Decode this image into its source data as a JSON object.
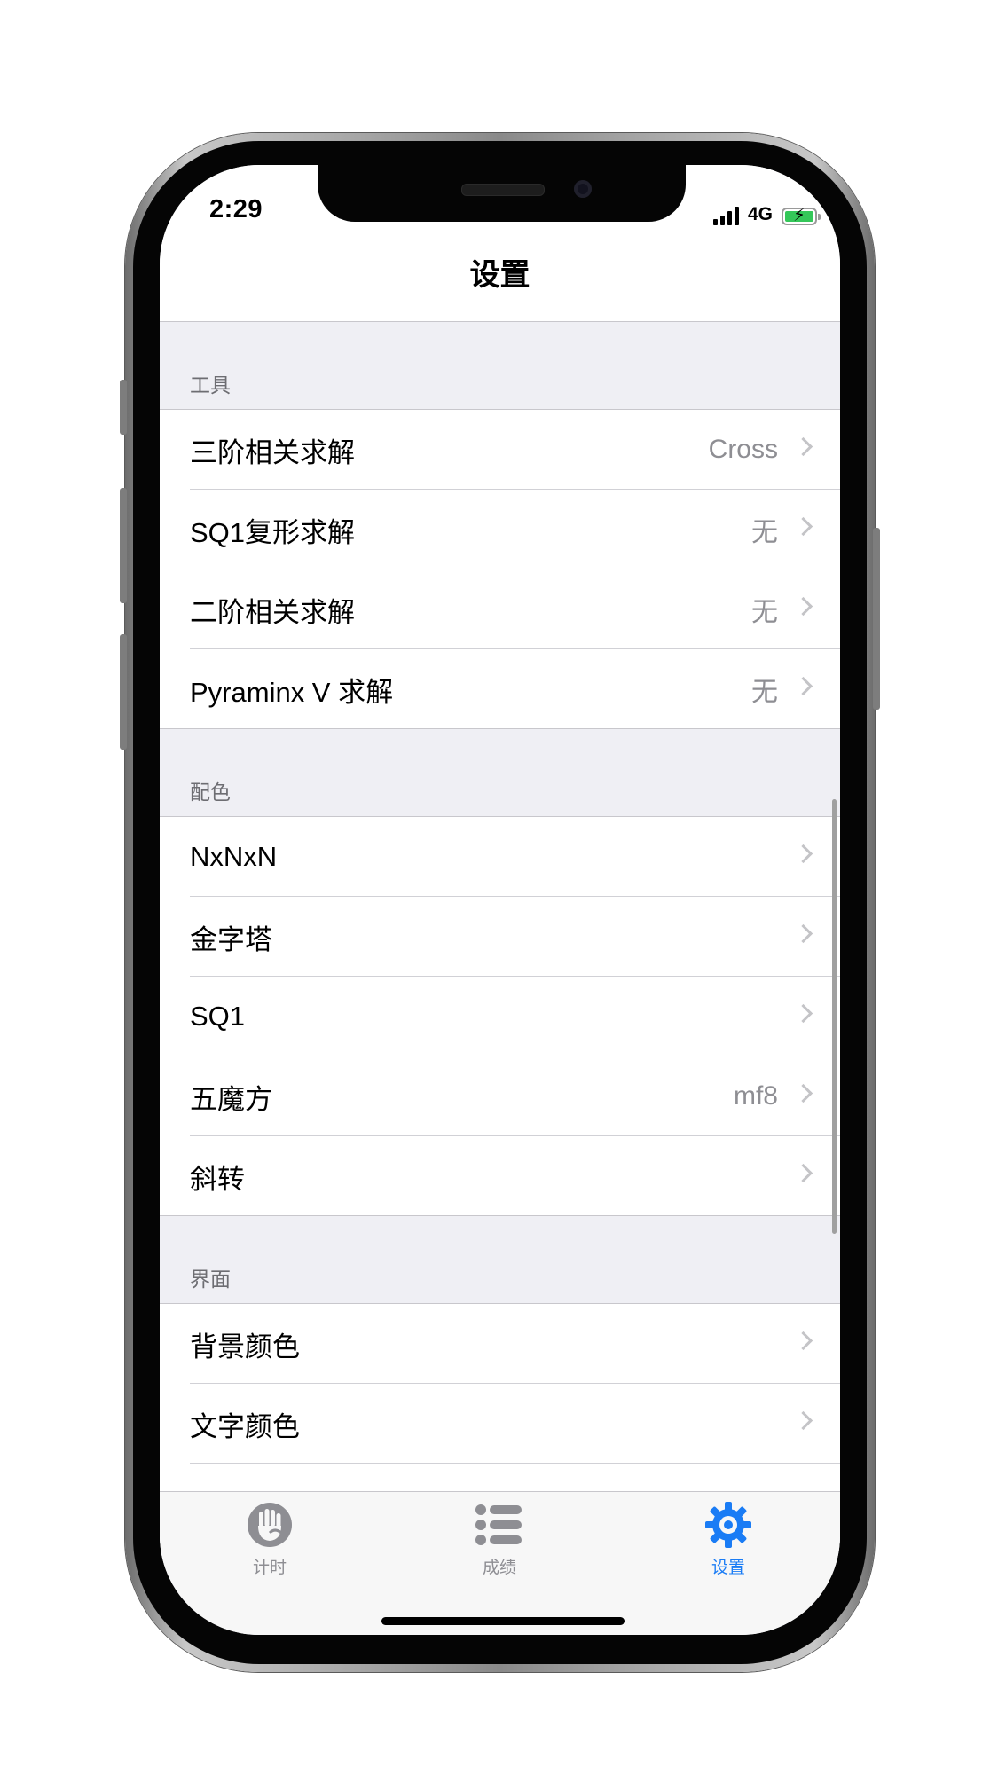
{
  "status_bar": {
    "time": "2:29",
    "network": "4G"
  },
  "nav": {
    "title": "设置"
  },
  "sections": [
    {
      "header": "工具",
      "items": [
        {
          "label": "三阶相关求解",
          "value": "Cross"
        },
        {
          "label": "SQ1复形求解",
          "value": "无"
        },
        {
          "label": "二阶相关求解",
          "value": "无"
        },
        {
          "label": "Pyraminx V 求解",
          "value": "无"
        }
      ]
    },
    {
      "header": "配色",
      "items": [
        {
          "label": "NxNxN",
          "value": ""
        },
        {
          "label": "金字塔",
          "value": ""
        },
        {
          "label": "SQ1",
          "value": ""
        },
        {
          "label": "五魔方",
          "value": "mf8"
        },
        {
          "label": "斜转",
          "value": ""
        }
      ]
    },
    {
      "header": "界面",
      "items": [
        {
          "label": "背景颜色",
          "value": ""
        },
        {
          "label": "文字颜色",
          "value": ""
        }
      ]
    }
  ],
  "tab_bar": {
    "tabs": [
      {
        "label": "计时",
        "icon": "hand-timer-icon",
        "active": false
      },
      {
        "label": "成绩",
        "icon": "list-icon",
        "active": false
      },
      {
        "label": "设置",
        "icon": "gear-icon",
        "active": true
      }
    ]
  },
  "colors": {
    "accent": "#1a7cf5",
    "inactive_tab": "#8e8e93",
    "grouped_background": "#efeff4"
  }
}
